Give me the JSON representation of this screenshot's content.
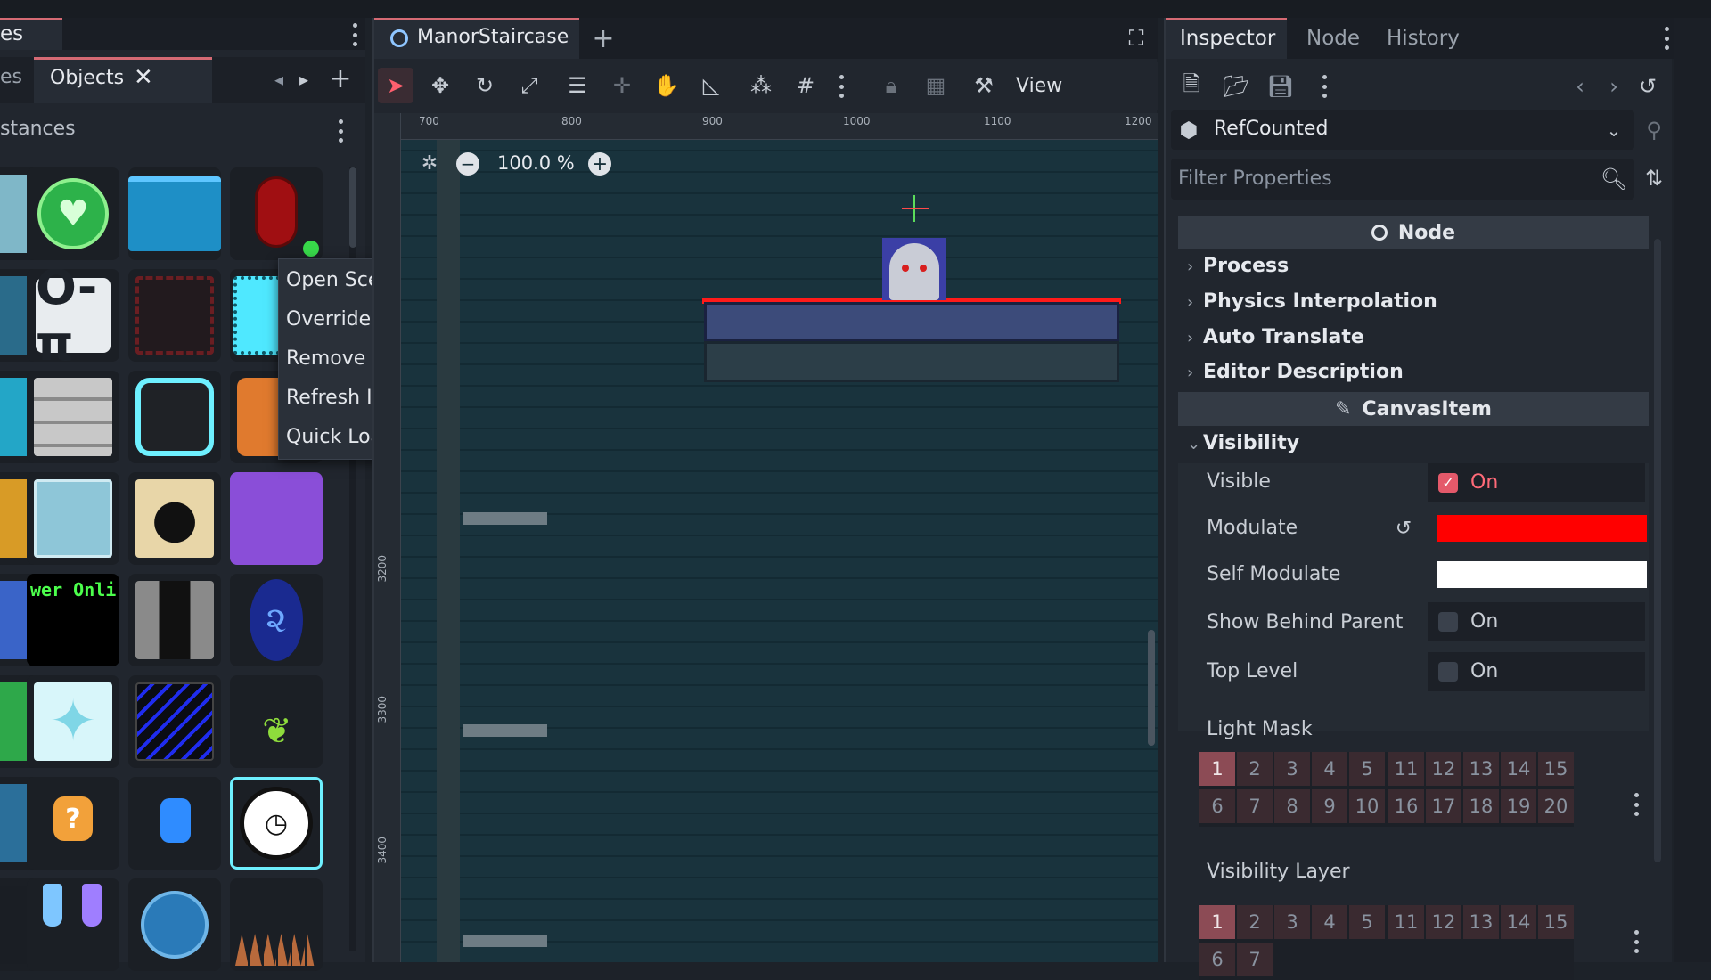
{
  "left_dock": {
    "top_tab_partial": "es",
    "tabs": [
      {
        "label": "es"
      },
      {
        "label": "Objects"
      }
    ],
    "instances_label": "stances",
    "tile_text": "wer Onli"
  },
  "context_menu": {
    "items": [
      "Open Scene",
      "Override Properties",
      "Remove",
      "Refresh Icon",
      "Quick Load..."
    ]
  },
  "viewport": {
    "scene_tab": "ManorStaircase",
    "view_label": "View",
    "zoom": "100.0 %",
    "ruler_h": [
      "700",
      "800",
      "900",
      "1000",
      "1100",
      "1200"
    ],
    "ruler_v": [
      "3200",
      "3300",
      "3400"
    ]
  },
  "inspector": {
    "tabs": [
      "Inspector",
      "Node",
      "History"
    ],
    "object_type": "RefCounted",
    "filter_placeholder": "Filter Properties",
    "node_section": "Node",
    "groups": [
      "Process",
      "Physics Interpolation",
      "Auto Translate",
      "Editor Description"
    ],
    "canvas_section": "CanvasItem",
    "visibility_group": "Visibility",
    "props": {
      "visible": {
        "label": "Visible",
        "value": "On",
        "checked": true
      },
      "modulate": {
        "label": "Modulate",
        "color": "#ff0000"
      },
      "self_modulate": {
        "label": "Self Modulate",
        "color": "#ffffff"
      },
      "show_behind_parent": {
        "label": "Show Behind Parent",
        "value": "On",
        "checked": false
      },
      "top_level": {
        "label": "Top Level",
        "value": "On",
        "checked": false
      }
    },
    "light_mask_label": "Light Mask",
    "visibility_layer_label": "Visibility Layer",
    "layer_numbers_top": [
      "1",
      "2",
      "3",
      "4",
      "5",
      "11",
      "12",
      "13",
      "14",
      "15"
    ],
    "layer_numbers_bottom": [
      "6",
      "7",
      "8",
      "9",
      "10",
      "16",
      "17",
      "18",
      "19",
      "20"
    ]
  },
  "colors": {
    "accent": "#d56a74",
    "selected_layer": "#8c4b55"
  }
}
